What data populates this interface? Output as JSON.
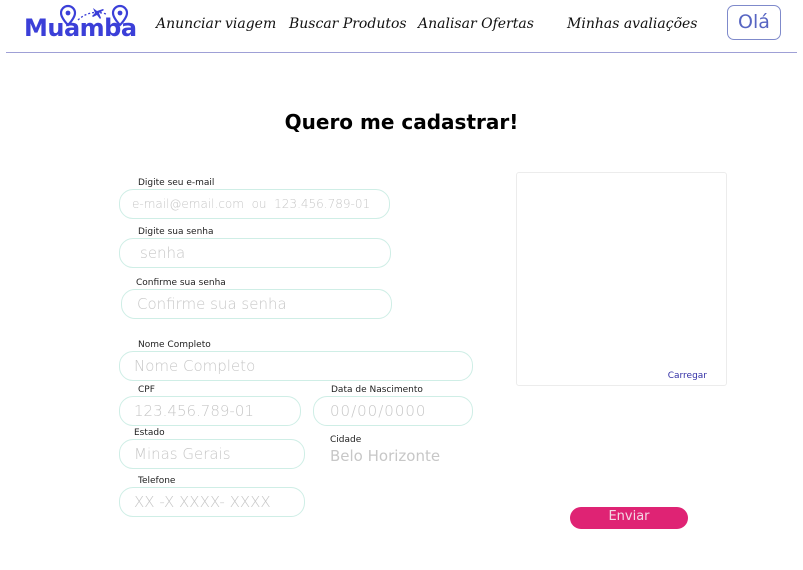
{
  "header": {
    "logo_text": "Muamba",
    "nav": [
      "Anunciar viagem",
      "Buscar Produtos",
      "Analisar Ofertas",
      "Minhas avaliações"
    ],
    "user_button": "Olá",
    "colors": {
      "brand": "#3b3fd8",
      "divider": "#9fa0d6"
    }
  },
  "page": {
    "title": "Quero me cadastrar!"
  },
  "form": {
    "email": {
      "label": "Digite seu e-mail",
      "placeholder": "e-mail@email.com  ou  123.456.789-01"
    },
    "password": {
      "label": "Digite sua senha",
      "placeholder": "senha"
    },
    "confirm_password": {
      "label": "Confirme sua senha",
      "placeholder": "Confirme sua senha"
    },
    "full_name": {
      "label": "Nome Completo",
      "placeholder": "Nome Completo"
    },
    "cpf": {
      "label": "CPF",
      "placeholder": "123.456.789-01"
    },
    "birth_date": {
      "label": "Data de Nascimento",
      "placeholder": "00/00/0000"
    },
    "state": {
      "label": "Estado",
      "placeholder": "Minas Gerais"
    },
    "city": {
      "label": "Cidade",
      "placeholder": "Belo Horizonte"
    },
    "phone": {
      "label": "Telefone",
      "placeholder": "XX -X XXXX- XXXX"
    }
  },
  "upload": {
    "link": "Carregar"
  },
  "submit": {
    "label": "Enviar",
    "color": "#df2374"
  }
}
